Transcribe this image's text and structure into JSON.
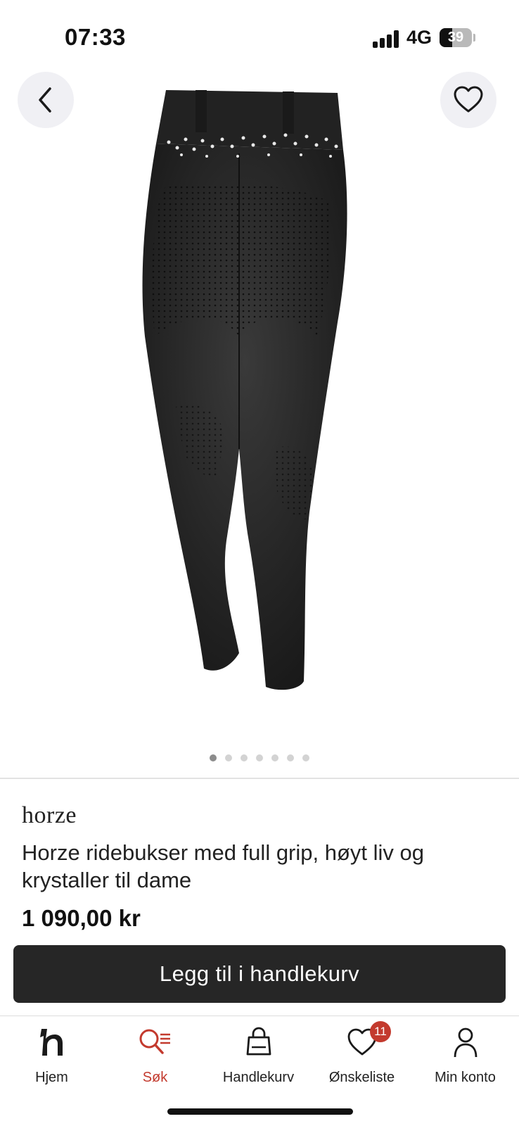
{
  "status_bar": {
    "time": "07:33",
    "network": "4G",
    "battery": "39",
    "battery_level": 0.39
  },
  "header": {
    "back_icon": "chevron-left-icon",
    "favorite_icon": "heart-outline-icon"
  },
  "carousel": {
    "image_count": 7,
    "active_index": 0
  },
  "product": {
    "brand": "horze",
    "title": "Horze ridebukser med full grip, høyt liv og krystaller til dame",
    "price": "1 090,00 kr"
  },
  "cart_button": {
    "label": "Legg til i handlekurv"
  },
  "bottom_nav": {
    "items": [
      {
        "label": "Hjem",
        "icon": "home-logo-icon"
      },
      {
        "label": "Søk",
        "icon": "search-icon",
        "active": true
      },
      {
        "label": "Handlekurv",
        "icon": "shopping-bag-icon"
      },
      {
        "label": "Ønskeliste",
        "icon": "heart-icon",
        "badge": "11"
      },
      {
        "label": "Min konto",
        "icon": "user-icon"
      }
    ]
  },
  "colors": {
    "accent": "#c33a2e",
    "button_bg": "#262626",
    "text": "#1f1f1f",
    "round_button_bg": "#f0f0f4"
  }
}
